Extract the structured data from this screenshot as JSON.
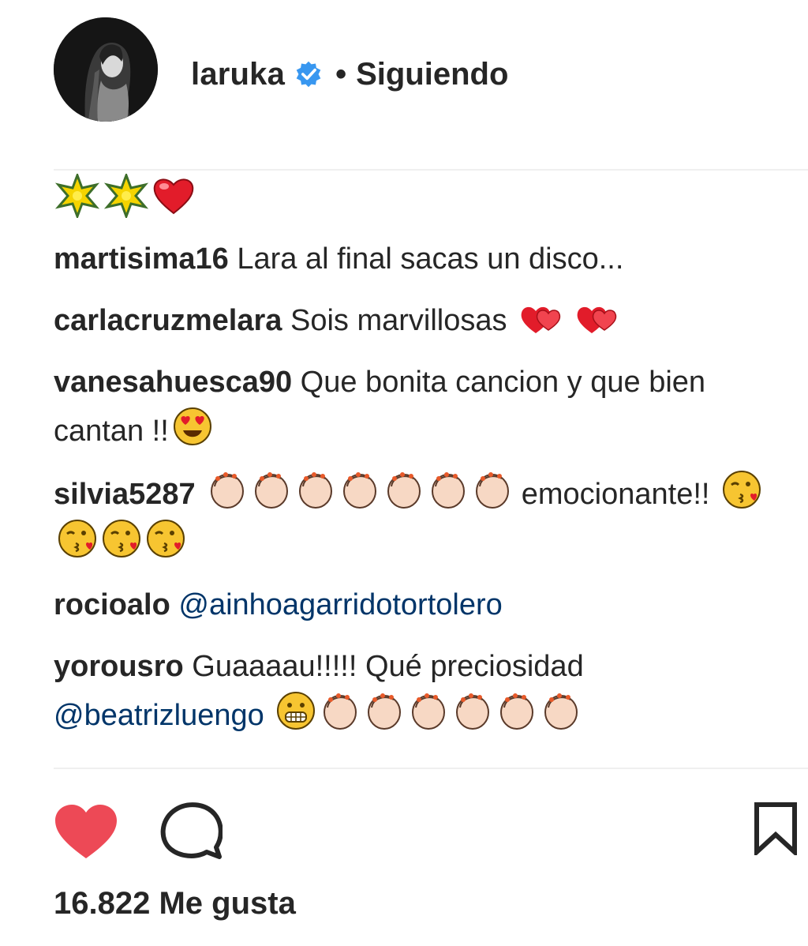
{
  "post": {
    "username": "laruka",
    "separator": "•",
    "follow_status": "Siguiendo",
    "likes": "16.822 Me gusta"
  },
  "icons": {
    "avatar": "profile-photo",
    "verified": "verified-badge-icon",
    "like": "heart-filled-icon",
    "comment": "speech-bubble-icon",
    "save": "bookmark-icon"
  },
  "colors": {
    "verified": "#3897f0",
    "liked_heart": "#ed4956",
    "mention": "#003569",
    "text": "#262626"
  },
  "caption": {
    "emojis": [
      "glowing-star",
      "glowing-star",
      "red-heart"
    ]
  },
  "comments": [
    {
      "user": "martisima16",
      "text": "Lara al final sacas un disco..."
    },
    {
      "user": "carlacruzmelara",
      "text": "Sois marvillosas",
      "emojis": [
        "two-hearts",
        "two-hearts"
      ]
    },
    {
      "user": "vanesahuesca90",
      "text": "Que bonita cancion y que bien cantan !!",
      "emojis": [
        "heart-eyes"
      ]
    },
    {
      "user": "silvia5287",
      "pre_emojis": [
        "clap",
        "clap",
        "clap",
        "clap",
        "clap",
        "clap",
        "clap"
      ],
      "text": "emocionante!!",
      "emojis": [
        "kiss-face",
        "kiss-face",
        "kiss-face",
        "kiss-face"
      ]
    },
    {
      "user": "rocioalo",
      "mention": "@ainhoagarridotortolero"
    },
    {
      "user": "yorousro",
      "text": "Guaaaau!!!!! Qué preciosidad",
      "mention": "@beatrizluengo",
      "emojis": [
        "grimace",
        "clap",
        "clap",
        "clap",
        "clap",
        "clap",
        "clap"
      ]
    }
  ]
}
